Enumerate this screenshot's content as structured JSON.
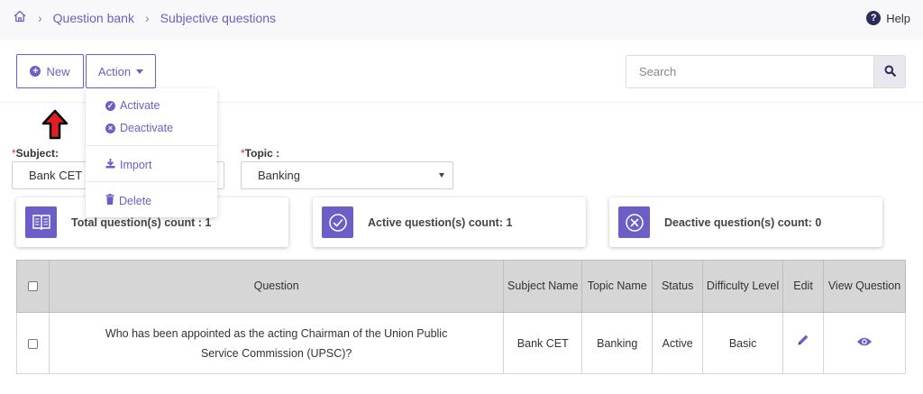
{
  "breadcrumb": {
    "home_icon": "home-icon",
    "items": [
      "Question bank",
      "Subjective questions"
    ]
  },
  "help": {
    "label": "Help",
    "icon": "question-circle-icon"
  },
  "toolbar": {
    "new_label": "New",
    "action_label": "Action",
    "search_placeholder": "Search"
  },
  "action_menu": {
    "items": [
      "Activate",
      "Deactivate",
      "Import",
      "Delete"
    ]
  },
  "filters": {
    "subject_label": "Subject:",
    "subject_value": "Bank CET",
    "topic_label": "Topic :",
    "topic_value": "Banking",
    "required_mark": "*"
  },
  "stats": [
    {
      "label": "Total question(s) count : 1",
      "icon": "book-icon"
    },
    {
      "label": "Active question(s) count: 1",
      "icon": "check-circle-icon"
    },
    {
      "label": "Deactive question(s) count: 0",
      "icon": "x-circle-icon"
    }
  ],
  "table": {
    "headers": [
      "Question",
      "Subject Name",
      "Topic Name",
      "Status",
      "Difficulty Level",
      "Edit",
      "View Question"
    ],
    "rows": [
      {
        "question": "Who has been appointed as the acting Chairman of the Union Public Service Commission (UPSC)?",
        "subject": "Bank CET",
        "topic": "Banking",
        "status": "Active",
        "difficulty": "Basic",
        "edit_icon": "pencil-icon",
        "view_icon": "eye-icon"
      }
    ]
  },
  "colors": {
    "accent": "#6b5fc7",
    "header_bg": "#d6d6d6",
    "required": "#e03030",
    "annotation_arrow": "#e02020"
  }
}
